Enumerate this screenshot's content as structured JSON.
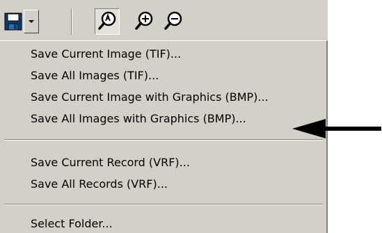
{
  "toolbar": {
    "icons": {
      "save": "floppy-disk-icon",
      "dropdown": "dropdown-arrow-icon",
      "zoom_auto": "magnifier-auto-icon",
      "zoom_in": "magnifier-plus-icon",
      "zoom_out": "magnifier-minus-icon"
    }
  },
  "menu": {
    "groups": [
      {
        "items": [
          {
            "label": "Save Current Image (TIF)..."
          },
          {
            "label": "Save All Images (TIF)..."
          },
          {
            "label": "Save Current Image with Graphics (BMP)..."
          },
          {
            "label": "Save All Images with Graphics (BMP)..."
          }
        ]
      },
      {
        "items": [
          {
            "label": "Save Current Record (VRF)..."
          },
          {
            "label": "Save All Records (VRF)..."
          }
        ]
      },
      {
        "items": [
          {
            "label": "Select Folder..."
          }
        ]
      }
    ]
  },
  "annotation": {
    "icon": "callout-arrow-icon",
    "target": "Save All Images with Graphics (BMP)..."
  },
  "colors": {
    "panel": "#d4d0c8",
    "save_icon": "#1a5a9a",
    "arrow": "#000000"
  }
}
